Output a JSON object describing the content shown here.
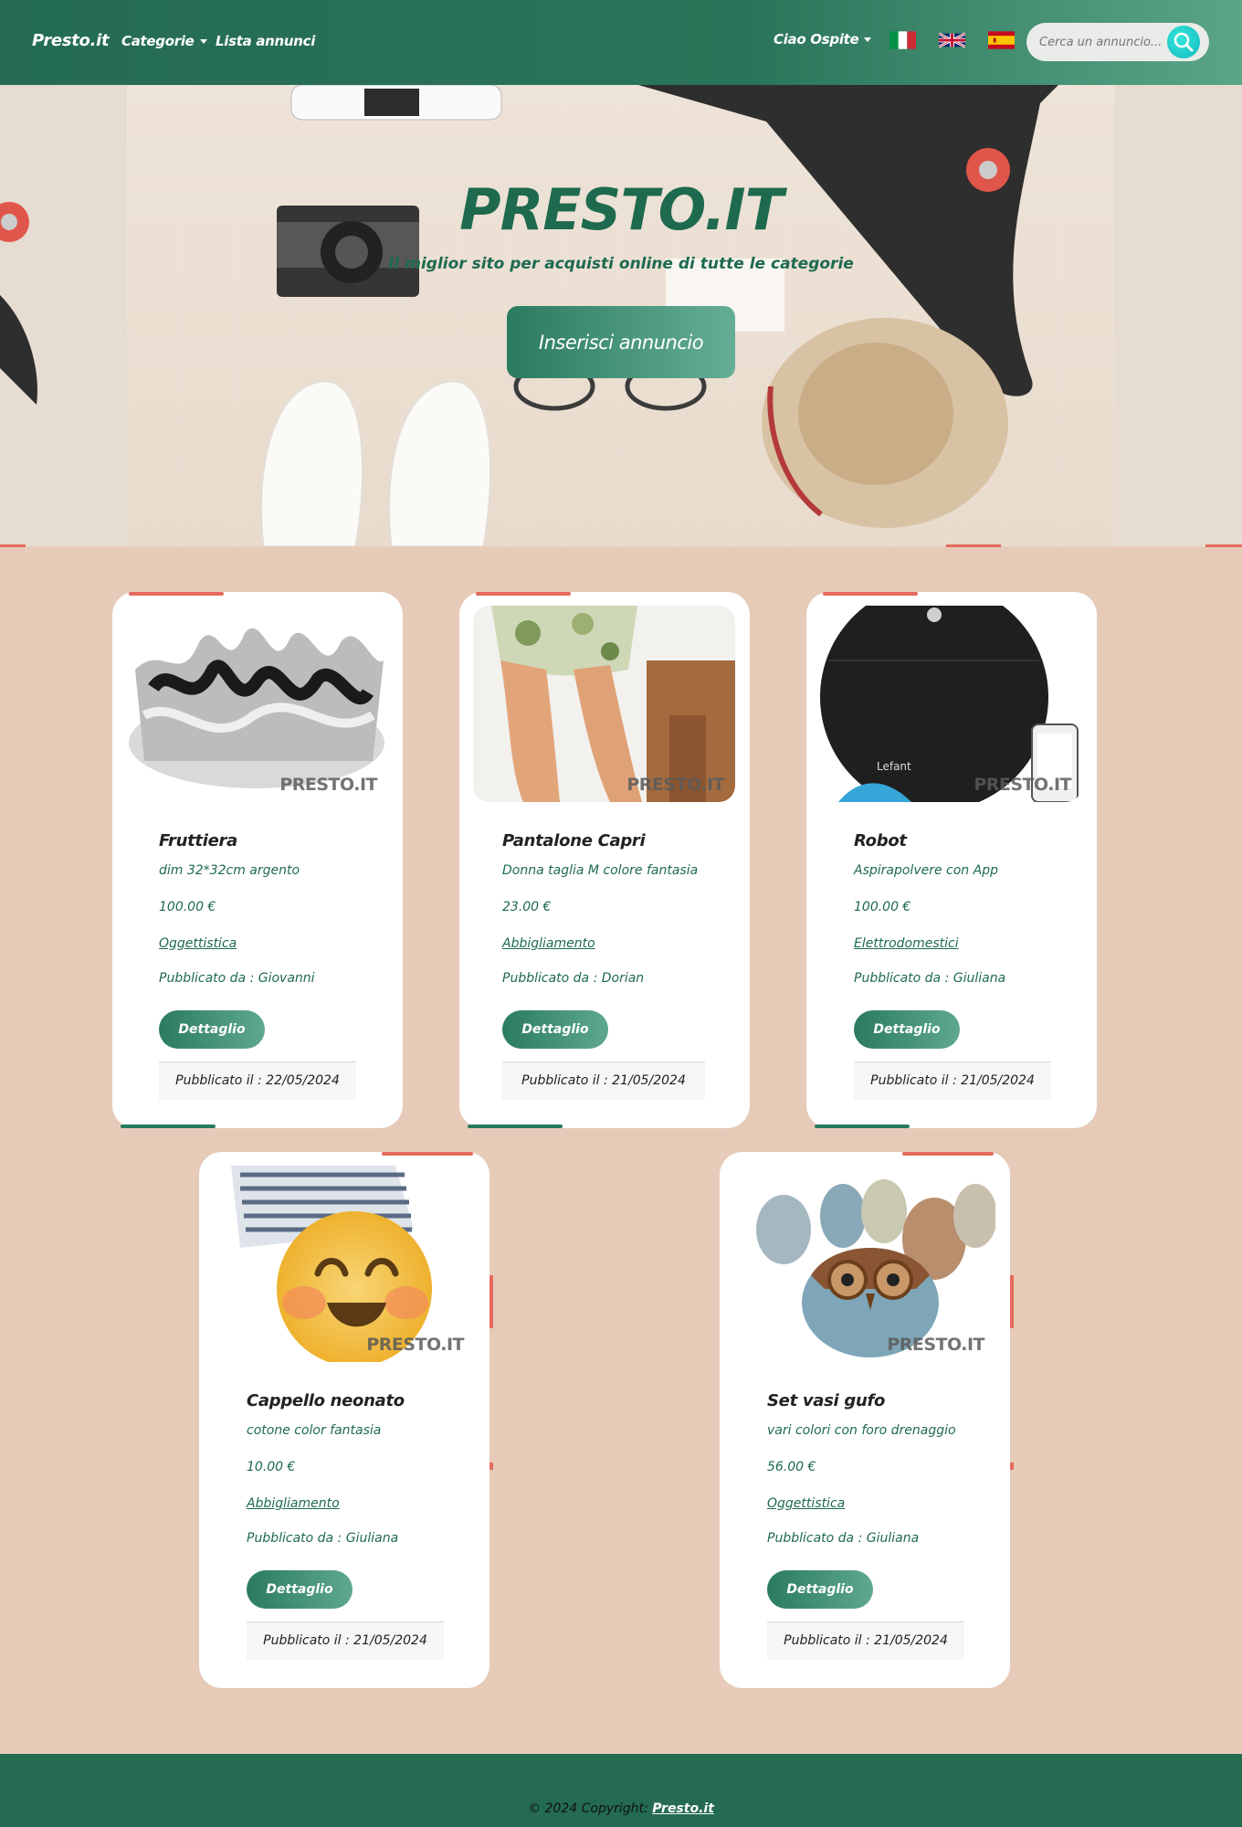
{
  "navbar": {
    "brand": "Presto.it",
    "categories_label": "Categorie",
    "listings_label": "Lista annunci",
    "user_label": "Ciao Ospite",
    "search_placeholder": "Cerca un annuncio..."
  },
  "hero": {
    "title": "PRESTO.IT",
    "subtitle": "Il miglior sito per acquisti online di tutte le categorie",
    "cta_label": "Inserisci annuncio"
  },
  "watermark": "PRESTO.IT",
  "listings": [
    {
      "title": "Fruttiera",
      "description": "dim 32*32cm argento",
      "price": "100.00 €",
      "category": "Oggettistica",
      "author": "Pubblicato da : Giovanni",
      "button": "Dettaglio",
      "date": "Pubblicato il : 22/05/2024"
    },
    {
      "title": "Pantalone Capri",
      "description": "Donna taglia M colore fantasia",
      "price": "23.00 €",
      "category": "Abbigliamento",
      "author": "Pubblicato da : Dorian",
      "button": "Dettaglio",
      "date": "Pubblicato il : 21/05/2024"
    },
    {
      "title": "Robot",
      "description": "Aspirapolvere con App",
      "price": "100.00 €",
      "category": "Elettrodomestici",
      "author": "Pubblicato da : Giuliana",
      "button": "Dettaglio",
      "date": "Pubblicato il : 21/05/2024"
    },
    {
      "title": "Cappello neonato",
      "description": "cotone color fantasia",
      "price": "10.00 €",
      "category": "Abbigliamento",
      "author": "Pubblicato da : Giuliana",
      "button": "Dettaglio",
      "date": "Pubblicato il : 21/05/2024"
    },
    {
      "title": "Set vasi gufo",
      "description": "vari colori con foro drenaggio",
      "price": "56.00 €",
      "category": "Oggettistica",
      "author": "Pubblicato da : Giuliana",
      "button": "Dettaglio",
      "date": "Pubblicato il : 21/05/2024"
    }
  ],
  "footer": {
    "copyright": "© 2024 Copyright:",
    "link": "Presto.it"
  },
  "colors": {
    "primary_green": "#246b52",
    "accent_red": "#e56a5d",
    "page_bg": "#e6cbb9"
  }
}
